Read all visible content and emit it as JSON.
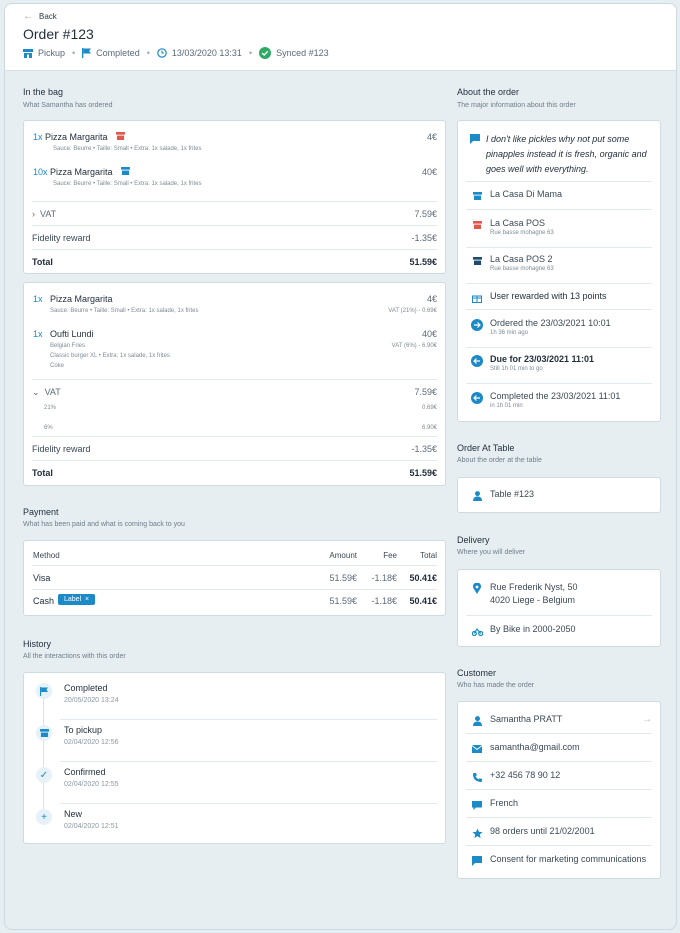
{
  "header": {
    "back": "Back",
    "title": "Order #123",
    "pickup": "Pickup",
    "status": "Completed",
    "datetime": "13/03/2020 13:31",
    "synced": "Synced #123"
  },
  "bag": {
    "title": "In the bag",
    "subtitle": "What Samantha has ordered"
  },
  "card1": {
    "items": [
      {
        "qty": "1x",
        "name": "Pizza Margarita",
        "details": "Sauce: Beurre  •  Taille: Small  •  Extra: 1x salade, 1x frites",
        "price": "4€"
      },
      {
        "qty": "10x",
        "name": "Pizza Margarita",
        "details": "Sauce: Beurre  •  Taille: Small  •  Extra: 1x salade, 1x frites",
        "price": "40€"
      }
    ],
    "vat_label": "VAT",
    "vat": "7.59€",
    "fidelity_label": "Fidelity reward",
    "fidelity": "-1.35€",
    "total_label": "Total",
    "total": "51.59€"
  },
  "card2": {
    "item1": {
      "qty": "1x",
      "name": "Pizza Margarita",
      "details": "Sauce: Beurre  •  Taille: Small  •  Extra: 1x salade, 1x frites",
      "vat": "VAT (21%) - 0.69€",
      "price": "4€"
    },
    "item2": {
      "qty": "1x",
      "name": "Oufti Lundi",
      "line1": "Belgian Fries",
      "line2": "Classic burger XL  •  Extra: 1x salade, 1x frites",
      "line3": "Coke",
      "vat": "VAT (6%) - 6.90€",
      "price": "40€"
    },
    "vat_label": "VAT",
    "vat": "7.59€",
    "vat21_label": "21%",
    "vat21": "0.69€",
    "vat6_label": "6%",
    "vat6": "6.90€",
    "fidelity_label": "Fidelity reward",
    "fidelity": "-1.35€",
    "total_label": "Total",
    "total": "51.59€"
  },
  "payment": {
    "title": "Payment",
    "subtitle": "What has been paid and what is coming back to you",
    "headers": {
      "method": "Method",
      "amount": "Amount",
      "fee": "Fee",
      "total": "Total"
    },
    "rows": [
      {
        "method": "Visa",
        "amount": "51.59€",
        "fee": "-1.18€",
        "total": "50.41€"
      },
      {
        "method": "Cash",
        "badge": "Label",
        "amount": "51.59€",
        "fee": "-1.18€",
        "total": "50.41€"
      }
    ]
  },
  "history": {
    "title": "History",
    "subtitle": "All the interactions with this order",
    "items": [
      {
        "label": "Completed",
        "date": "20/05/2020 13:24"
      },
      {
        "label": "To pickup",
        "date": "02/04/2020 12:56"
      },
      {
        "label": "Confirmed",
        "date": "02/04/2020 12:55"
      },
      {
        "label": "New",
        "date": "02/04/2020 12:51"
      }
    ]
  },
  "about": {
    "title": "About the order",
    "subtitle": "The major information about this order",
    "note": "I don't like pickles why not put some pinapples instead it is fresh, organic and goes well with everything.",
    "shop1": "La Casa Di Mama",
    "shop2": "La Casa POS",
    "shop2_addr": "Rue basse mohagne 63",
    "shop3": "La Casa POS 2",
    "shop3_addr": "Rue basse mohagne 63",
    "reward": "User rewarded with 13 points",
    "ordered": "Ordered the 23/03/2021 10:01",
    "ordered_sub": "1h 36 min ago",
    "due": "Due for 23/03/2021 11:01",
    "due_sub": "Still 1h 01 min to go",
    "completed": "Completed the 23/03/2021 11:01",
    "completed_sub": "in 1h 01 min"
  },
  "table": {
    "title": "Order At Table",
    "subtitle": "About the order at the table",
    "value": "Table #123"
  },
  "delivery": {
    "title": "Delivery",
    "subtitle": "Where you will deliver",
    "addr1": "Rue Frederik Nyst, 50",
    "addr2": "4020 Liege - Belgium",
    "mode": "By Bike in 2000-2050"
  },
  "customer": {
    "title": "Customer",
    "subtitle": "Who has made the order",
    "name": "Samantha PRATT",
    "email": "samantha@gmail.com",
    "phone": "+32 456 78 90 12",
    "lang": "French",
    "orders": "98 orders until 21/02/2001",
    "consent": "Consent for marketing communications"
  }
}
